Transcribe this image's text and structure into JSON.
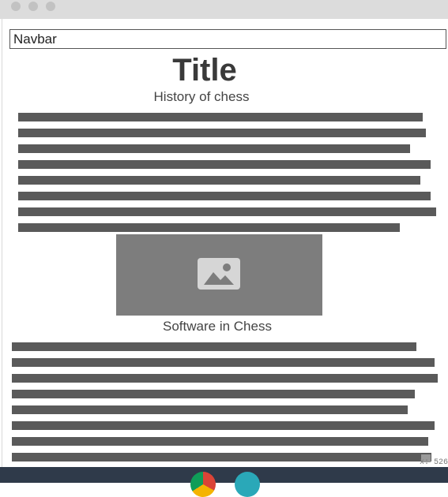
{
  "window": {
    "controls": [
      "close",
      "minimize",
      "maximize"
    ]
  },
  "navbar": {
    "label": "Navbar"
  },
  "content": {
    "title": "Title",
    "section1_heading": "History of chess",
    "section2_heading": "Software in Chess"
  },
  "image": {
    "icon": "image-placeholder-icon"
  },
  "status": {
    "coord_readout": "x: 526"
  },
  "taskbar": {
    "icons": [
      "chrome-icon",
      "app-icon"
    ]
  },
  "colors": {
    "text_lines": "#5a5a5a",
    "image_placeholder": "#7d7d7d",
    "taskbar": "#2f3a4a"
  }
}
